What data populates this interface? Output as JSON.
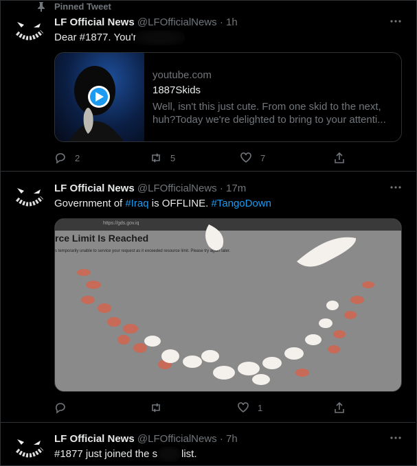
{
  "pinned_label": "Pinned Tweet",
  "tweets": [
    {
      "name": "LF Official News",
      "handle": "@LFOfficialNews",
      "sep": "·",
      "time": "1h",
      "text": "Dear #1877. You're",
      "card": {
        "domain": "youtube.com",
        "title": "1887Skids",
        "desc1": "Well, isn't this just cute. From one skid to the next,",
        "desc2": "huh?Today we're delighted to bring to your attenti..."
      },
      "replies": "2",
      "retweets": "5",
      "likes": "7"
    },
    {
      "name": "LF Official News",
      "handle": "@LFOfficialNews",
      "sep": "·",
      "time": "17m",
      "text_prefix": "Government of ",
      "tag1": "#Iraq",
      "text_mid": " is OFFLINE. ",
      "tag2": "#TangoDown",
      "image": {
        "url": "https://gds.gov.iq",
        "heading": "rce Limit Is Reached",
        "body": "s temporarily unable to service your request as it exceeded resource limit. Please try again later."
      },
      "replies": "",
      "retweets": "",
      "likes": "1"
    },
    {
      "name": "LF Official News",
      "handle": "@LFOfficialNews",
      "sep": "·",
      "time": "7h",
      "text_a": "#1877 just joined the s",
      "text_b": "list."
    }
  ],
  "more_icon": "more-horizontal-icon",
  "colors": {
    "link": "#1d9bf0",
    "muted": "#71767b",
    "border": "#2f3336"
  }
}
